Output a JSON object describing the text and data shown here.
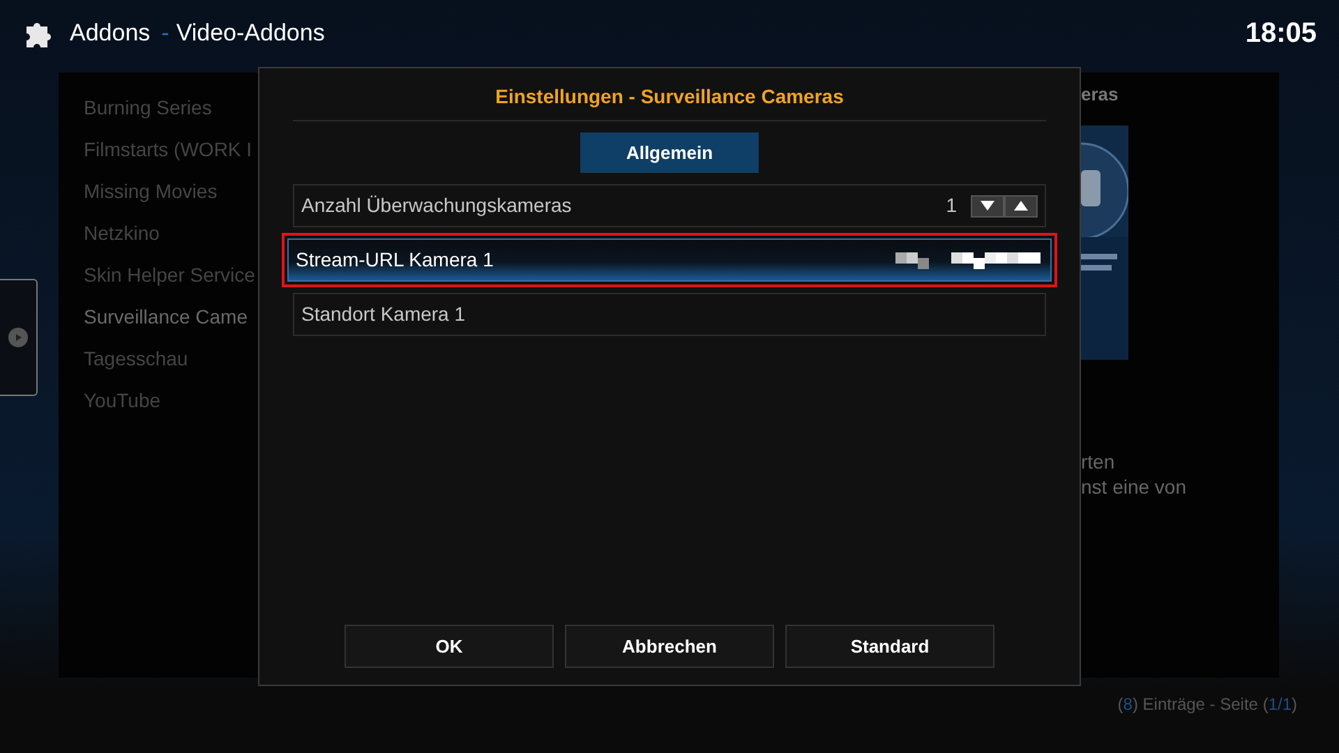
{
  "header": {
    "title": "Addons",
    "separator": "-",
    "subtitle": "Video-Addons",
    "clock": "18:05"
  },
  "addon_list": {
    "items": [
      {
        "label": "Burning Series",
        "selected": false
      },
      {
        "label": "Filmstarts (WORK I",
        "selected": false
      },
      {
        "label": "Missing Movies",
        "selected": false
      },
      {
        "label": "Netzkino",
        "selected": false
      },
      {
        "label": "Skin Helper Service",
        "selected": false
      },
      {
        "label": "Surveillance Came",
        "selected": true
      },
      {
        "label": "Tagesschau",
        "selected": false
      },
      {
        "label": "YouTube",
        "selected": false
      }
    ]
  },
  "dialog": {
    "title": "Einstellungen - Surveillance Cameras",
    "categories": [
      {
        "label": "Allgemein",
        "selected": true
      }
    ],
    "settings": [
      {
        "kind": "spinner",
        "label": "Anzahl Überwachungskameras",
        "value": "1",
        "selected": false,
        "outlined": false
      },
      {
        "kind": "text",
        "label": "Stream-URL Kamera 1",
        "redacted": true,
        "selected": true,
        "outlined": true
      },
      {
        "kind": "text",
        "label": "Standort Kamera 1",
        "redacted": false,
        "selected": false,
        "outlined": false
      }
    ],
    "buttons": [
      "OK",
      "Abbrechen",
      "Standard"
    ]
  },
  "info_panel": {
    "title": "eras",
    "thumbnail": {
      "kind": "picture"
    },
    "description_lines": [
      "rten",
      "nst eine von"
    ]
  },
  "footer": {
    "parts": [
      {
        "text": "(",
        "accent": false
      },
      {
        "text": "8",
        "accent": true
      },
      {
        "text": ") Einträge - Seite (",
        "accent": false
      },
      {
        "text": "1/1",
        "accent": true
      },
      {
        "text": ")",
        "accent": false
      }
    ]
  }
}
